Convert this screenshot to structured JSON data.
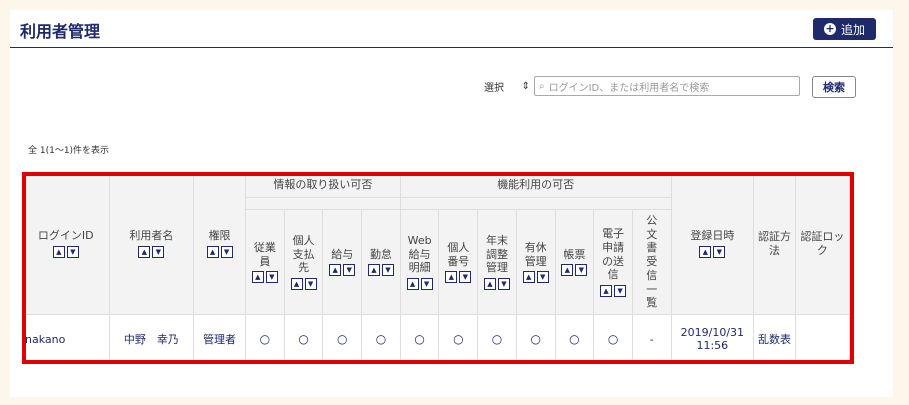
{
  "page_title": "利用者管理",
  "add_button_label": "追加",
  "search": {
    "select_value": "選択",
    "placeholder": "ログインID、または利用者名で検索",
    "button_label": "検索"
  },
  "result_count": "全 1(1〜1)件を表示",
  "table": {
    "group_info": "情報の取り扱い可否",
    "group_function": "機能利用の可否",
    "col_login_id": "ログインID",
    "col_user_name": "利用者名",
    "col_authority": "権限",
    "col_employee": "従業員",
    "col_personal_payment": "個人支払先",
    "col_salary": "給与",
    "col_attendance": "勤怠",
    "col_web_payslip": "Web給与明細",
    "col_personal_number": "個人番号",
    "col_year_end": "年末調整管理",
    "col_paid_leave": "有休管理",
    "col_forms": "帳票",
    "col_e_application": "電子申請の送信",
    "col_official_doc": "公文書受信一覧",
    "col_registered": "登録日時",
    "col_auth_method": "認証方法",
    "col_auth_lock": "認証ロック",
    "sort_up": "▲",
    "sort_down": "▼",
    "row": {
      "login_id": "nakano",
      "user_name": "中野　幸乃",
      "authority": "管理者",
      "employee": "○",
      "personal_payment": "○",
      "salary": "○",
      "attendance": "○",
      "web_payslip": "○",
      "personal_number": "○",
      "year_end": "○",
      "paid_leave": "○",
      "forms": "○",
      "e_application": "○",
      "official_doc": "-",
      "registered": "2019/10/31 11:56",
      "auth_method": "乱数表",
      "auth_lock": ""
    }
  },
  "colors": {
    "navy": "#1f2a6b",
    "highlight_border": "#e00000",
    "background": "#fdf6ea"
  },
  "icons": {
    "add": "plus-circle-icon",
    "search": "search-icon",
    "sort_up": "sort-up-icon",
    "sort_down": "sort-down-icon"
  }
}
